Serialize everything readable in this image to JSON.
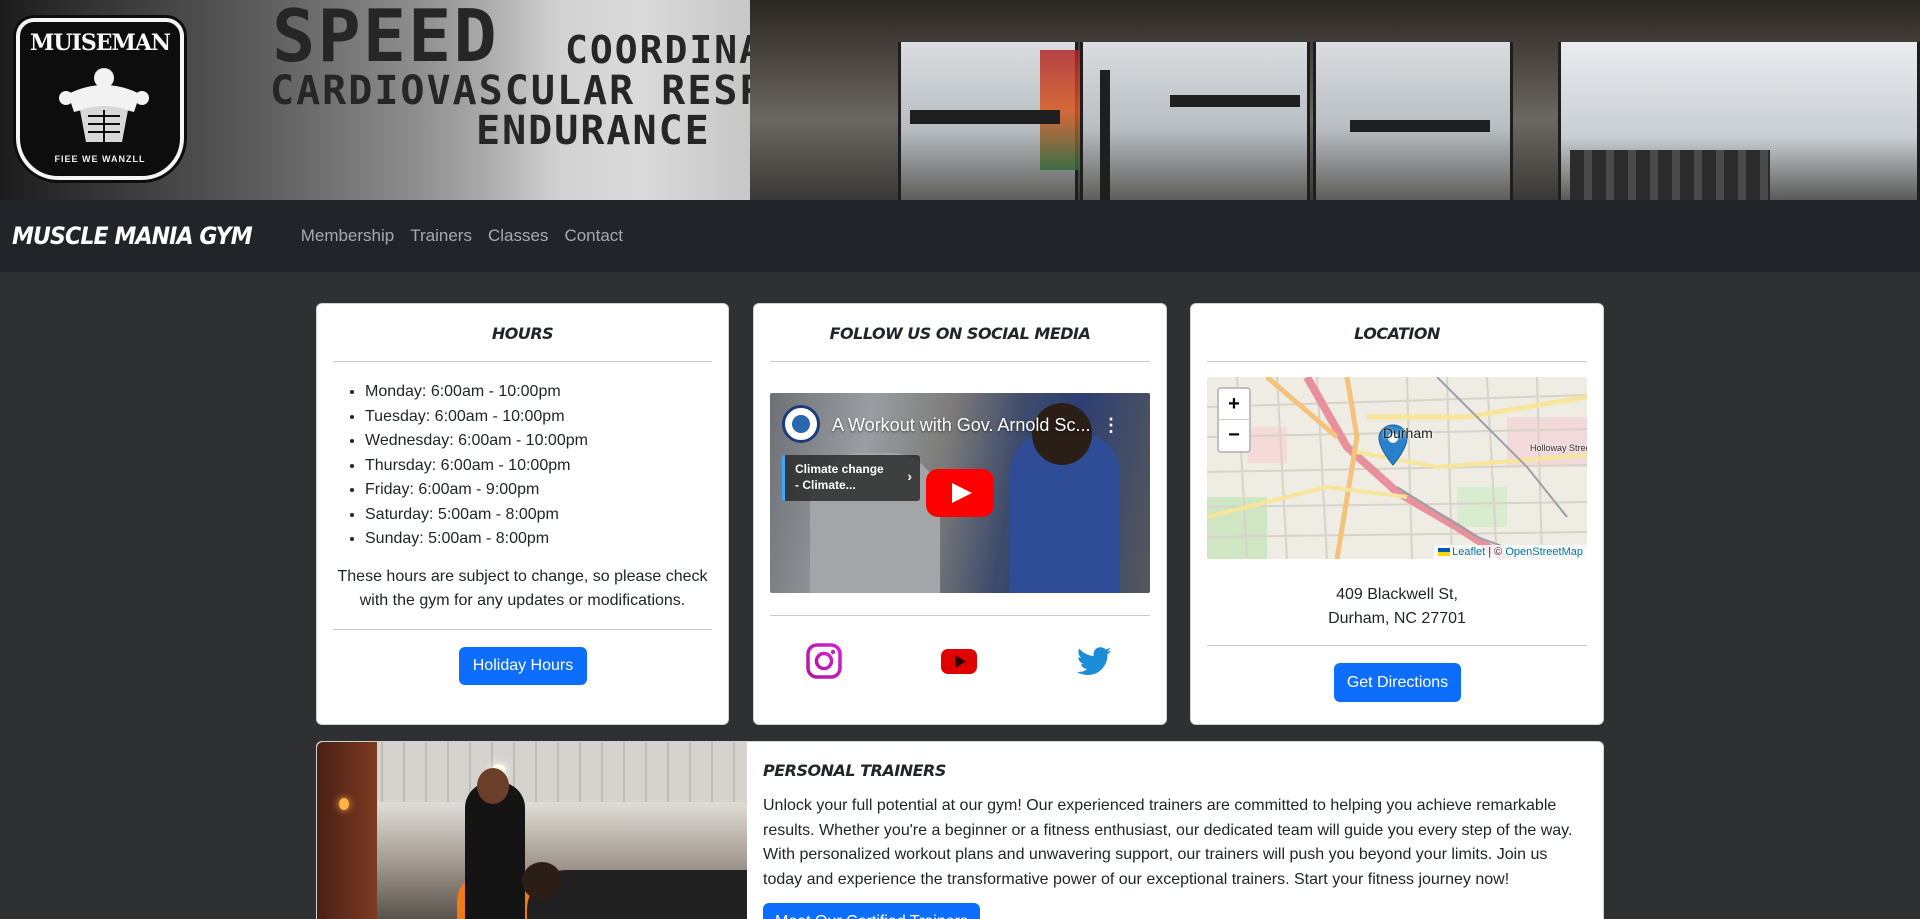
{
  "banner": {
    "logo_title": "MUISEMAN",
    "logo_subtitle": "FIEE WE WANZLL",
    "wall_text": [
      "SPEED",
      "COORDINA",
      "CARDIOVASCULAR RESPIR",
      "ENDURANCE"
    ]
  },
  "navbar": {
    "brand": "MUSCLE MANIA GYM",
    "links": [
      "Membership",
      "Trainers",
      "Classes",
      "Contact"
    ]
  },
  "hours": {
    "title": "HOURS",
    "items": [
      "Monday: 6:00am - 10:00pm",
      "Tuesday: 6:00am - 10:00pm",
      "Wednesday: 6:00am - 10:00pm",
      "Thursday: 6:00am - 10:00pm",
      "Friday: 6:00am - 9:00pm",
      "Saturday: 5:00am - 8:00pm",
      "Sunday: 5:00am - 8:00pm"
    ],
    "note": "These hours are subject to change, so please check with the gym for any updates or modifications.",
    "button": "Holiday Hours"
  },
  "social": {
    "title": "FOLLOW US ON SOCIAL MEDIA",
    "video": {
      "title": "A Workout with Gov. Arnold Sc...",
      "chip_line1": "Climate change",
      "chip_line2": "- Climate..."
    },
    "icons": [
      "instagram-icon",
      "youtube-icon",
      "twitter-icon"
    ]
  },
  "location": {
    "title": "LOCATION",
    "map": {
      "zoom_in": "+",
      "zoom_out": "−",
      "city_label": "Durham",
      "street_label": "Holloway Street",
      "attribution_leaflet": "Leaflet",
      "attribution_sep": " | © ",
      "attribution_osm": "OpenStreetMap"
    },
    "address_line1": "409 Blackwell St,",
    "address_line2": "Durham, NC 27701",
    "button": "Get Directions"
  },
  "trainers": {
    "title": "PERSONAL TRAINERS",
    "text": "Unlock your full potential at our gym! Our experienced trainers are committed to helping you achieve remarkable results. Whether you're a beginner or a fitness enthusiast, our dedicated team will guide you every step of the way. With personalized workout plans and unwavering support, our trainers will push you beyond your limits. Join us today and experience the transformative power of our exceptional trainers. Start your fitness journey now!",
    "button": "Meet Our Certified Trainers"
  },
  "colors": {
    "page_bg": "#2f3031",
    "navbar_bg": "#212529",
    "primary": "#0d6efd",
    "instagram": "#c13584",
    "youtube": "#e00000",
    "twitter": "#1d9bf0"
  }
}
